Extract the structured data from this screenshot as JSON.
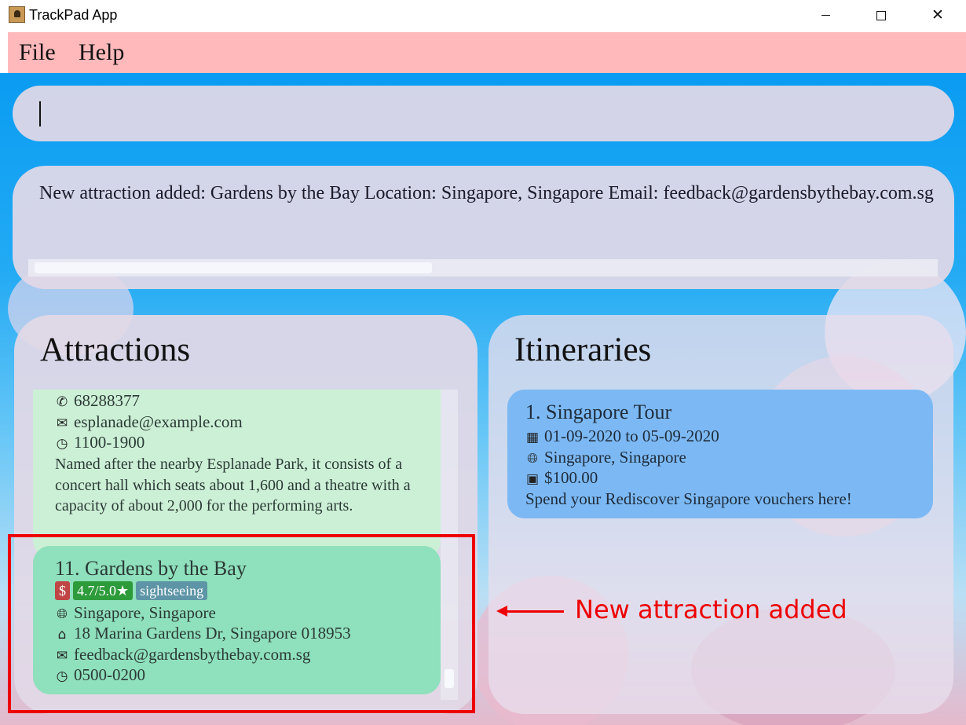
{
  "window": {
    "title": "TrackPad App",
    "minimize_icon": "minimize-icon",
    "maximize_icon": "maximize-icon",
    "close_glyph": "✕"
  },
  "menu": {
    "file": "File",
    "help": "Help"
  },
  "command_box": {
    "value": ""
  },
  "result_display": {
    "text": "New attraction added: Gardens by the Bay Location: Singapore, Singapore Email: feedback@gardensbythebay.com.sg"
  },
  "attractions": {
    "heading": "Attractions",
    "previous_card": {
      "phone": "68288377",
      "email": "esplanade@example.com",
      "hours": "1100-1900",
      "description": "Named after the nearby Esplanade Park, it consists of a concert hall which seats about 1,600 and a theatre with a capacity of about 2,000 for the performing arts."
    },
    "new_card": {
      "title": "11.  Gardens by the Bay",
      "price_badge": "$",
      "rating_badge": "4.7/5.0★",
      "tag": "sightseeing",
      "location": "Singapore, Singapore",
      "address": "18 Marina Gardens Dr, Singapore 018953",
      "email": "feedback@gardensbythebay.com.sg",
      "hours": "0500-0200"
    }
  },
  "itineraries": {
    "heading": "Itineraries",
    "cards": [
      {
        "title": "1.  Singapore Tour",
        "dates": "01-09-2020 to 05-09-2020",
        "location": "Singapore, Singapore",
        "budget": "$100.00",
        "description": "Spend your Rediscover Singapore vouchers here!"
      }
    ]
  },
  "annotation": {
    "text": "New attraction added",
    "color": "#ee0000"
  },
  "colors": {
    "menubar": "#ffb9bb",
    "new_card": "#8fe0bc",
    "itinerary_card": "#7cb9f4"
  }
}
